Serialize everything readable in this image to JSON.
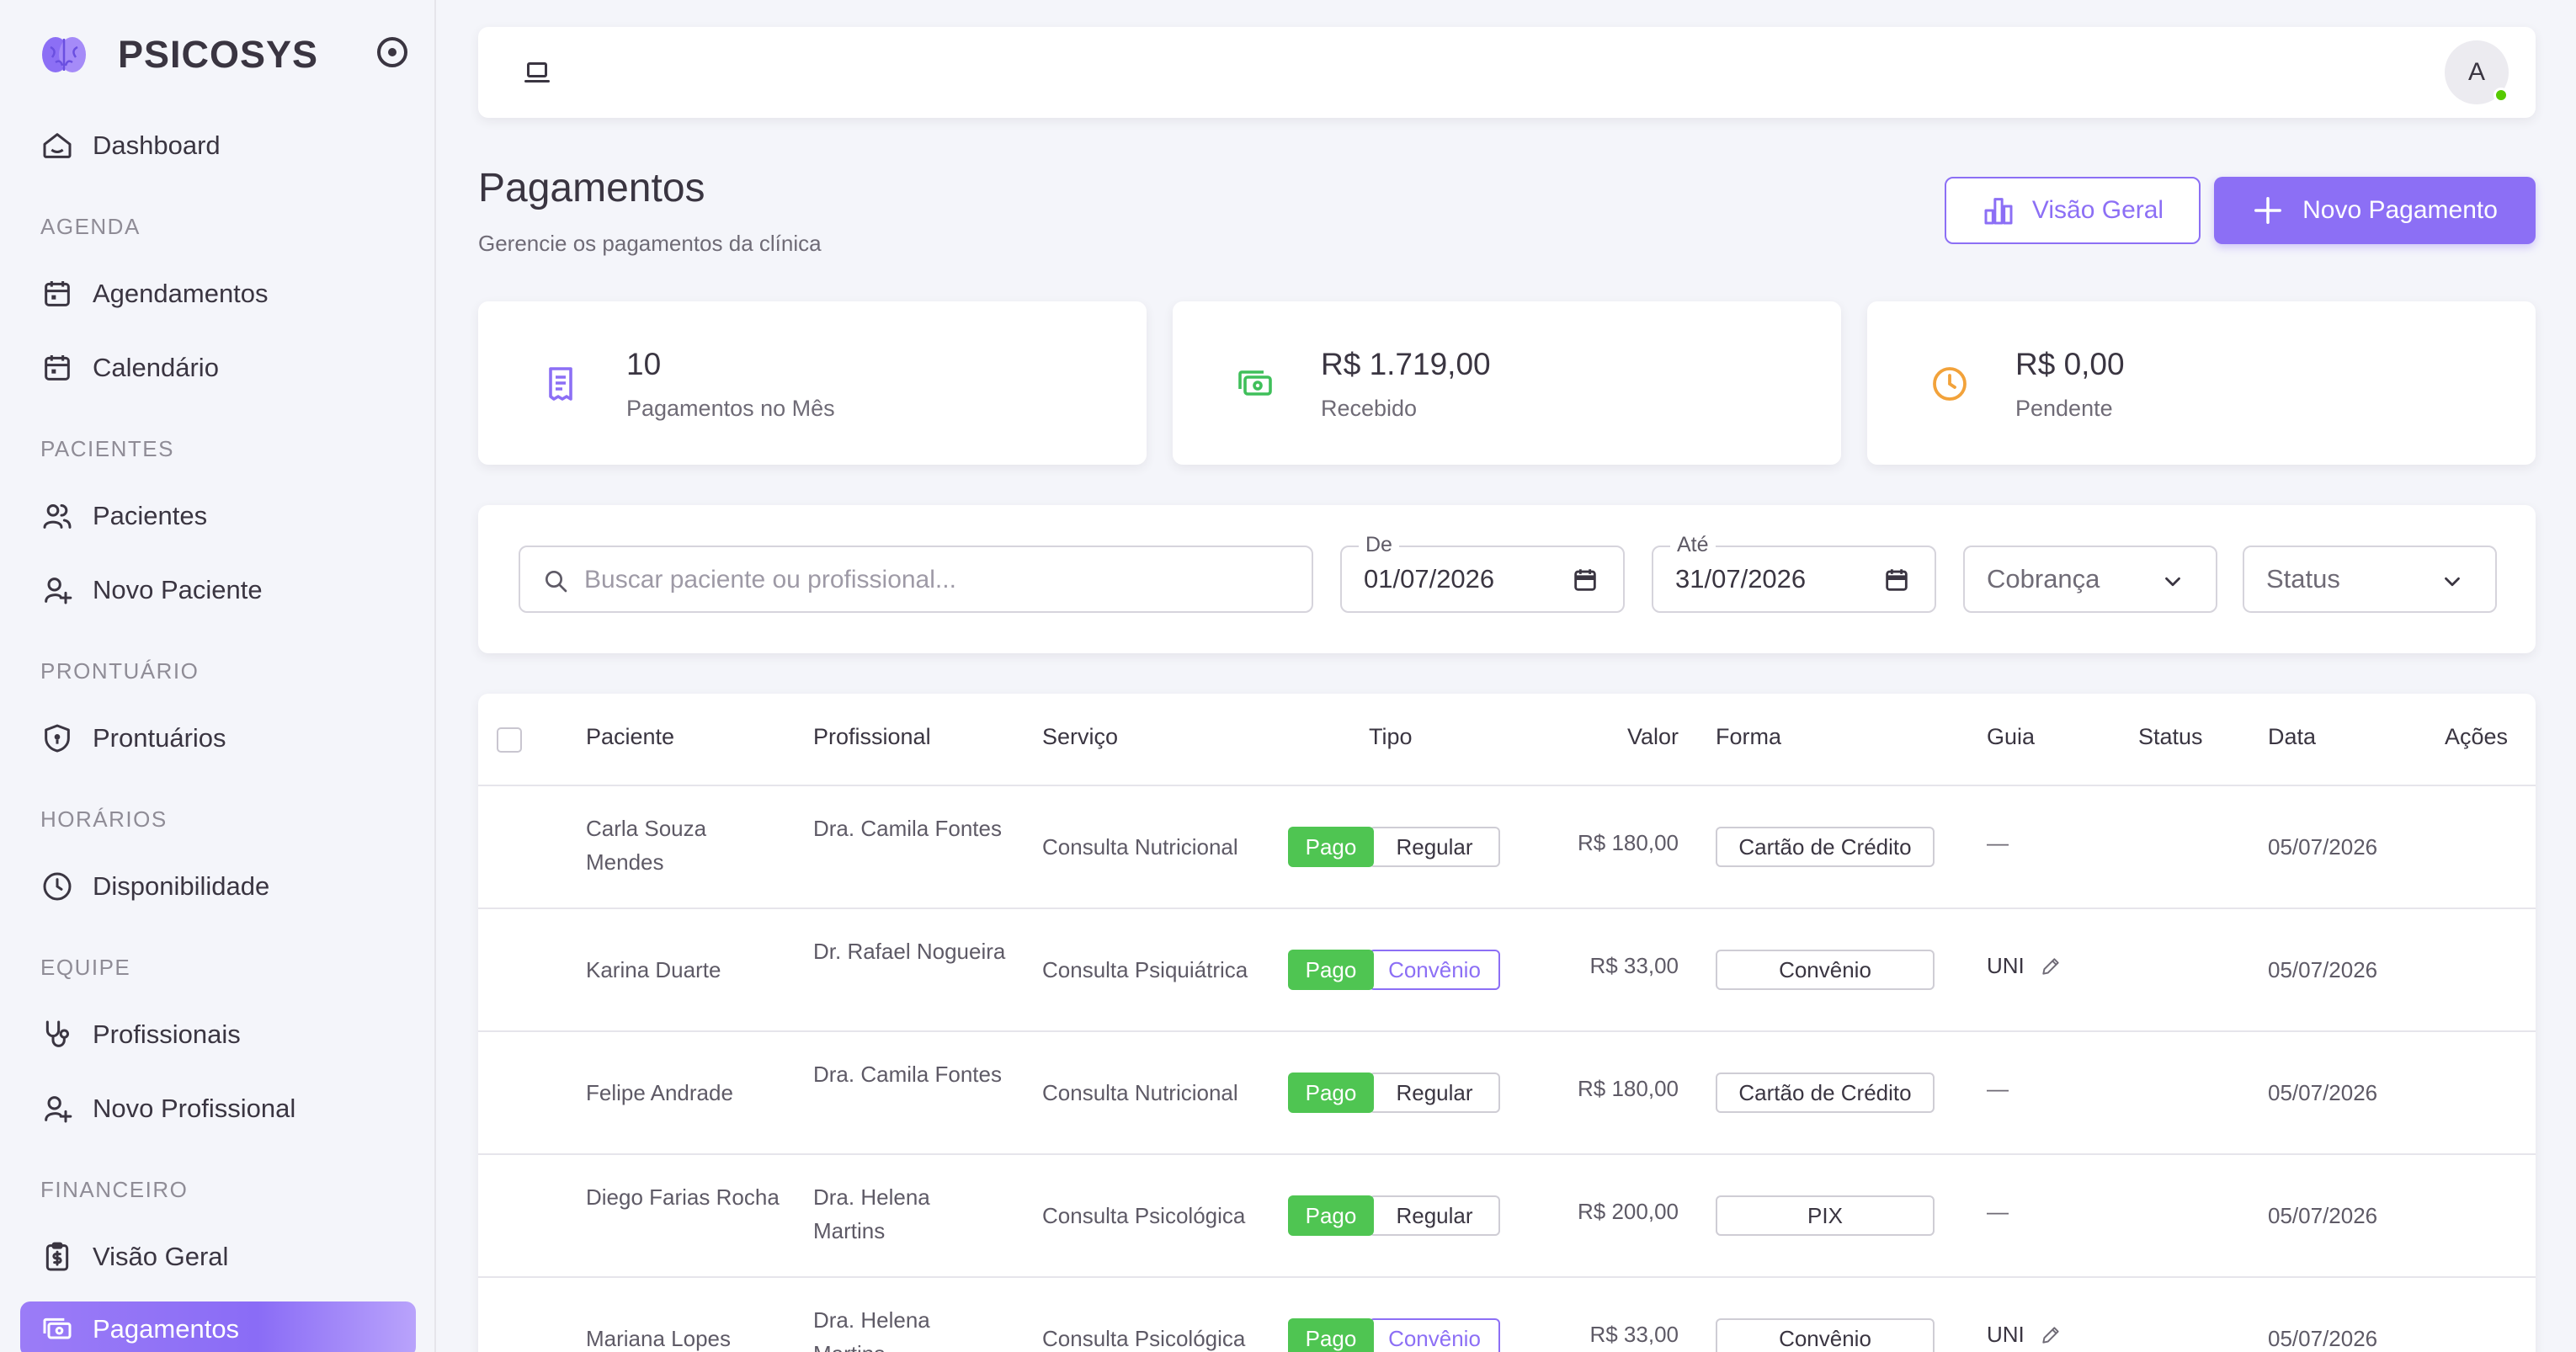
{
  "brand": {
    "name": "PSICOSYS"
  },
  "sidebar": {
    "dashboard": "Dashboard",
    "sections": [
      "AGENDA",
      "PACIENTES",
      "PRONTUÁRIO",
      "HORÁRIOS",
      "EQUIPE",
      "FINANCEIRO"
    ],
    "items": [
      {
        "label": "Agendamentos",
        "icon": "calendar-icon"
      },
      {
        "label": "Calendário",
        "icon": "calendar-icon"
      },
      {
        "label": "Pacientes",
        "icon": "users-icon"
      },
      {
        "label": "Novo Paciente",
        "icon": "user-plus-icon"
      },
      {
        "label": "Prontuários",
        "icon": "shield-icon"
      },
      {
        "label": "Disponibilidade",
        "icon": "clock-icon"
      },
      {
        "label": "Profissionais",
        "icon": "stethoscope-icon"
      },
      {
        "label": "Novo Profissional",
        "icon": "user-plus-icon"
      },
      {
        "label": "Visão Geral",
        "icon": "clipboard-dollar-icon"
      },
      {
        "label": "Pagamentos",
        "icon": "cash-icon",
        "active": true
      }
    ]
  },
  "topbar": {
    "avatar_initial": "A"
  },
  "header": {
    "title": "Pagamentos",
    "subtitle": "Gerencie os pagamentos da clínica",
    "overview_button": "Visão Geral",
    "new_button": "Novo Pagamento"
  },
  "stats": [
    {
      "value": "10",
      "label": "Pagamentos no Mês",
      "color": "#8c6ff5"
    },
    {
      "value": "R$ 1.719,00",
      "label": "Recebido",
      "color": "#3fbf5a"
    },
    {
      "value": "R$ 0,00",
      "label": "Pendente",
      "color": "#f2a23a"
    }
  ],
  "filters": {
    "search_placeholder": "Buscar paciente ou profissional...",
    "from_label": "De",
    "from_value": "01/07/2026",
    "to_label": "Até",
    "to_value": "31/07/2026",
    "billing": "Cobrança",
    "status": "Status"
  },
  "table": {
    "headers": [
      "Paciente",
      "Profissional",
      "Serviço",
      "Tipo",
      "Valor",
      "Forma",
      "Guia",
      "Status",
      "Data",
      "Ações"
    ],
    "rows": [
      {
        "patient": "Carla Souza Mendes",
        "professional": "Dra. Camila Fontes",
        "service": "Consulta Nutricional",
        "type": "Regular",
        "value": "R$ 180,00",
        "method": "Cartão de Crédito",
        "guide": "—",
        "status": "Pago",
        "date": "05/07/2026"
      },
      {
        "patient": "Karina Duarte",
        "professional": "Dr. Rafael Nogueira",
        "service": "Consulta Psiquiátrica",
        "type": "Convênio",
        "value": "R$ 33,00",
        "method": "Convênio",
        "guide": "UNI",
        "status": "Pago",
        "date": "05/07/2026"
      },
      {
        "patient": "Felipe Andrade",
        "professional": "Dra. Camila Fontes",
        "service": "Consulta Nutricional",
        "type": "Regular",
        "value": "R$ 180,00",
        "method": "Cartão de Crédito",
        "guide": "—",
        "status": "Pago",
        "date": "05/07/2026"
      },
      {
        "patient": "Diego Farias Rocha",
        "professional": "Dra. Helena Martins",
        "service": "Consulta Psicológica",
        "type": "Regular",
        "value": "R$ 200,00",
        "method": "PIX",
        "guide": "—",
        "status": "Pago",
        "date": "05/07/2026"
      },
      {
        "patient": "Mariana Lopes",
        "professional": "Dra. Helena Martins",
        "service": "Consulta Psicológica",
        "type": "Convênio",
        "value": "R$ 33,00",
        "method": "Convênio",
        "guide": "UNI",
        "status": "Pago",
        "date": "05/07/2026"
      }
    ]
  }
}
